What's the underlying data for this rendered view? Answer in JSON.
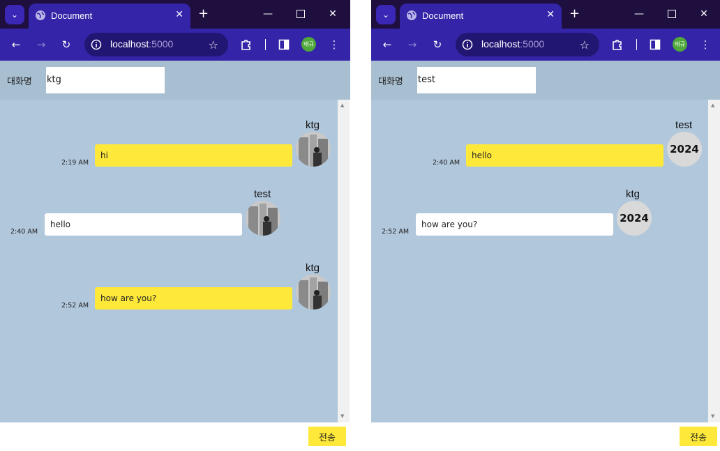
{
  "windows": [
    {
      "tab_title": "Document",
      "address_host": "localhost",
      "address_port": ":5000",
      "profile": "태규",
      "name_label": "대화명",
      "name_value": "ktg",
      "send_label": "전송",
      "messages": [
        {
          "sender": "ktg",
          "text": "hi",
          "time": "2:19 AM",
          "mine": true,
          "avatar": "photo"
        },
        {
          "sender": "test",
          "text": "hello",
          "time": "2:40 AM",
          "mine": false,
          "avatar": "photo"
        },
        {
          "sender": "ktg",
          "text": "how are you?",
          "time": "2:52 AM",
          "mine": true,
          "avatar": "photo"
        }
      ]
    },
    {
      "tab_title": "Document",
      "address_host": "localhost",
      "address_port": ":5000",
      "profile": "태규",
      "name_label": "대화명",
      "name_value": "test",
      "send_label": "전송",
      "messages": [
        {
          "sender": "test",
          "text": "hello",
          "time": "2:40 AM",
          "mine": true,
          "avatar": "2024"
        },
        {
          "sender": "ktg",
          "text": "how are you?",
          "time": "2:52 AM",
          "mine": false,
          "avatar": "2024"
        }
      ]
    }
  ],
  "colors": {
    "mine_bubble": "#fee83a",
    "other_bubble": "#ffffff",
    "chat_bg": "#b1c7dc",
    "header_bg": "#a8bfd2",
    "browser_accent": "#3324a8"
  }
}
